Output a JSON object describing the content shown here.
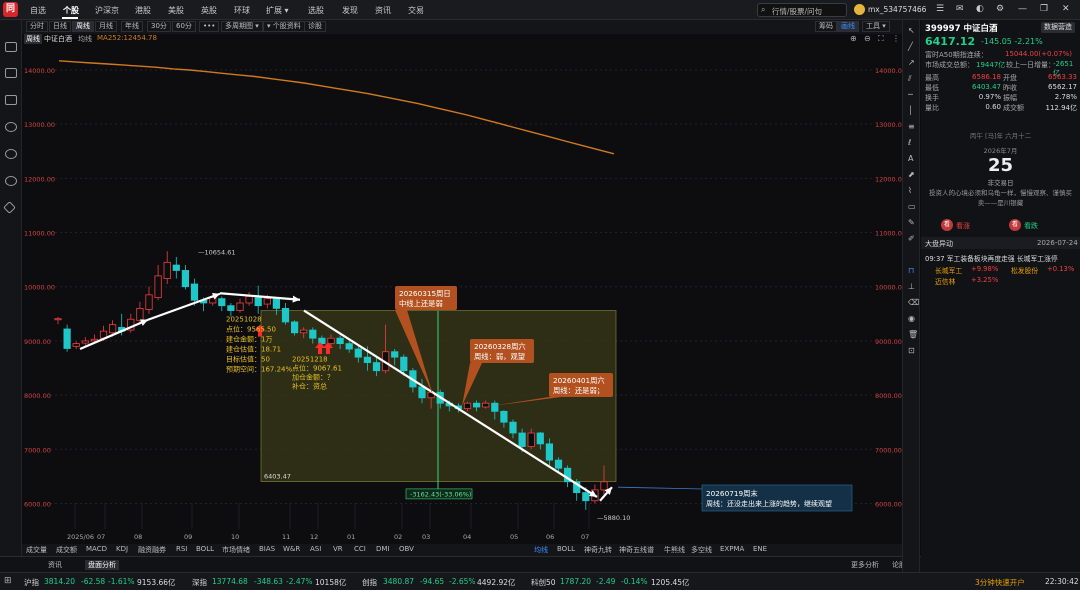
{
  "app": {
    "logo": "同花顺",
    "title": "中证白酒"
  },
  "nav": [
    {
      "label": "自选",
      "x": 30
    },
    {
      "label": "个股",
      "x": 63,
      "active": true
    },
    {
      "label": "沪深京",
      "x": 95
    },
    {
      "label": "港股",
      "x": 135
    },
    {
      "label": "美股",
      "x": 168
    },
    {
      "label": "英股",
      "x": 201
    },
    {
      "label": "环球",
      "x": 234
    },
    {
      "label": "扩展 ▾",
      "x": 266
    },
    {
      "label": "选股",
      "x": 308
    },
    {
      "label": "发现",
      "x": 342
    },
    {
      "label": "资讯",
      "x": 375
    },
    {
      "label": "交易",
      "x": 408
    }
  ],
  "search": {
    "placeholder": "行情/股票/问句"
  },
  "user": {
    "name": "mx_534757466"
  },
  "toolbar": [
    {
      "label": "分时",
      "x": 4
    },
    {
      "label": "日线",
      "x": 27
    },
    {
      "label": "周线",
      "x": 50,
      "sel": true
    },
    {
      "label": "月线",
      "x": 73
    },
    {
      "label": "年线",
      "x": 99
    },
    {
      "label": "30分",
      "x": 125
    },
    {
      "label": "60分",
      "x": 150
    },
    {
      "label": "•••",
      "x": 177
    },
    {
      "label": "多周期图 ▾",
      "x": 199
    },
    {
      "label": "▾ 个股资料",
      "x": 241
    },
    {
      "label": "诊股",
      "x": 282
    }
  ],
  "toolbar_right": [
    {
      "label": "筹码",
      "x": 793
    },
    {
      "label": "画线",
      "x": 815,
      "sel": true
    },
    {
      "label": "工具 ▾",
      "x": 840
    }
  ],
  "legend": {
    "period": "周线",
    "name": "中证白酒",
    "ma_label": "均线",
    "ma": "MA252:12454.78"
  },
  "chart_data": {
    "type": "candlestick",
    "y_ticks": [
      14000,
      13000,
      12000,
      11000,
      10000,
      9000,
      8000,
      7000,
      6000
    ],
    "y_tick_labels": [
      "14000.00",
      "13000.00",
      "12000.00",
      "11000.00",
      "10000.00",
      "9000.00",
      "8000.00",
      "7000.00",
      "6000.00"
    ],
    "x_labels": [
      "2025/06",
      "07",
      "08",
      "09",
      "10",
      "11",
      "12",
      "01",
      "02",
      "03",
      "04",
      "05",
      "06",
      "07"
    ],
    "high_label": "10654.61",
    "low_label": "5880.10",
    "box_low_label": "6403.47",
    "measure_label": "-3162.43(-33.06%)",
    "candles": [
      [
        9390,
        9410,
        9310,
        9440
      ],
      [
        9220,
        8860,
        8800,
        9300
      ],
      [
        8900,
        8950,
        8850,
        8990
      ],
      [
        8960,
        9000,
        8920,
        9070
      ],
      [
        9000,
        9030,
        8960,
        9120
      ],
      [
        9050,
        9180,
        9000,
        9280
      ],
      [
        9150,
        9300,
        9080,
        9380
      ],
      [
        9250,
        9180,
        9100,
        9500
      ],
      [
        9200,
        9400,
        9150,
        9500
      ],
      [
        9380,
        9600,
        9300,
        9720
      ],
      [
        9580,
        9850,
        9500,
        10000
      ],
      [
        9800,
        10200,
        9750,
        10400
      ],
      [
        10150,
        10450,
        10050,
        10654
      ],
      [
        10400,
        10300,
        10150,
        10550
      ],
      [
        10300,
        10000,
        9950,
        10400
      ],
      [
        10050,
        9750,
        9650,
        10150
      ],
      [
        9750,
        9700,
        9550,
        9800
      ],
      [
        9700,
        9800,
        9650,
        9850
      ],
      [
        9780,
        9650,
        9550,
        9820
      ],
      [
        9650,
        9560,
        9450,
        9700
      ],
      [
        9560,
        9700,
        9520,
        9780
      ],
      [
        9700,
        9820,
        9650,
        9900
      ],
      [
        9800,
        9650,
        9500,
        10020
      ],
      [
        9680,
        9780,
        9600,
        9850
      ],
      [
        9770,
        9600,
        9480,
        9800
      ],
      [
        9600,
        9350,
        9300,
        9700
      ],
      [
        9350,
        9150,
        9100,
        9380
      ],
      [
        9150,
        9200,
        9050,
        9250
      ],
      [
        9200,
        9050,
        8950,
        9250
      ],
      [
        9050,
        8950,
        8880,
        9100
      ],
      [
        8950,
        9050,
        8900,
        9120
      ],
      [
        9050,
        8950,
        8850,
        9100
      ],
      [
        8950,
        8850,
        8780,
        9000
      ],
      [
        8850,
        8700,
        8600,
        8900
      ],
      [
        8700,
        8600,
        8450,
        8900
      ],
      [
        8600,
        8450,
        8350,
        8700
      ],
      [
        8450,
        8800,
        8400,
        9300
      ],
      [
        8800,
        8700,
        8550,
        8850
      ],
      [
        8700,
        8450,
        8350,
        8750
      ],
      [
        8450,
        8150,
        8050,
        8500
      ],
      [
        8150,
        7950,
        7850,
        8300
      ],
      [
        7950,
        8050,
        7750,
        8100
      ],
      [
        8050,
        7850,
        7750,
        8100
      ],
      [
        7850,
        7800,
        7700,
        7900
      ],
      [
        7800,
        7750,
        7680,
        7850
      ],
      [
        7750,
        7850,
        7700,
        7880
      ],
      [
        7850,
        7780,
        7700,
        7900
      ],
      [
        7780,
        7850,
        7750,
        7900
      ],
      [
        7850,
        7700,
        7550,
        7900
      ],
      [
        7700,
        7500,
        7400,
        7720
      ],
      [
        7500,
        7300,
        7200,
        7550
      ],
      [
        7300,
        7050,
        6950,
        7380
      ],
      [
        7050,
        7300,
        7000,
        7380
      ],
      [
        7300,
        7100,
        7000,
        7320
      ],
      [
        7100,
        6800,
        6700,
        7200
      ],
      [
        6800,
        6650,
        6550,
        6850
      ],
      [
        6650,
        6400,
        6300,
        6700
      ],
      [
        6400,
        6200,
        6050,
        6450
      ],
      [
        6200,
        6050,
        5880,
        6300
      ],
      [
        6050,
        6250,
        6000,
        6350
      ],
      [
        6250,
        6400,
        6150,
        6700
      ]
    ],
    "ma252": [
      14170,
      14150,
      14130,
      14110,
      14090,
      14070,
      14050,
      14020,
      14000,
      13970,
      13940,
      13910,
      13880,
      13840,
      13800,
      13760,
      13710,
      13660,
      13610,
      13560,
      13500,
      13440,
      13380,
      13310,
      13240,
      13170,
      13090,
      13010,
      12930,
      12850,
      12770,
      12690,
      12610,
      12530,
      12454
    ]
  },
  "annotations": [
    {
      "lines": [
        "20251028",
        "点位：9565.50",
        "建仓金额：1万",
        "建仓估值：18.71",
        "目标估值：50",
        "预期空间：167.24%"
      ]
    },
    {
      "lines": [
        "20251218",
        "点位：9067.61",
        "加仓金额：？",
        "补仓：资总"
      ]
    },
    {
      "box": "20260315周日",
      "sub": "中线上还是弱"
    },
    {
      "box": "20260328周六",
      "sub": "周线：弱，观望"
    },
    {
      "box": "20260401周六",
      "sub": "周线：还是弱；"
    },
    {
      "box": "20260719周末",
      "sub": "周线：还没走出来上涨的趋势，继续观望"
    }
  ],
  "bottom_tabs": [
    {
      "label": "成交量",
      "x": 4
    },
    {
      "label": "成交额",
      "x": 34
    },
    {
      "label": "MACD",
      "x": 64
    },
    {
      "label": "KDJ",
      "x": 94
    },
    {
      "label": "融资融券",
      "x": 116
    },
    {
      "label": "RSI",
      "x": 154
    },
    {
      "label": "BOLL",
      "x": 174
    },
    {
      "label": "市场情绪",
      "x": 200
    },
    {
      "label": "BIAS",
      "x": 237
    },
    {
      "label": "W&R",
      "x": 261
    },
    {
      "label": "ASI",
      "x": 288
    },
    {
      "label": "VR",
      "x": 311
    },
    {
      "label": "CCI",
      "x": 332
    },
    {
      "label": "DMI",
      "x": 354
    },
    {
      "label": "OBV",
      "x": 377
    },
    {
      "label": "均线",
      "x": 512,
      "sel": true
    },
    {
      "label": "BOLL",
      "x": 535
    },
    {
      "label": "神奇九转",
      "x": 562
    },
    {
      "label": "神奇五线谱",
      "x": 597
    },
    {
      "label": "牛熊线",
      "x": 642
    },
    {
      "label": "多空线",
      "x": 669
    },
    {
      "label": "EXPMA",
      "x": 698
    },
    {
      "label": "ENE",
      "x": 731
    }
  ],
  "panel_tabs": [
    {
      "label": "资讯",
      "x": 48
    },
    {
      "label": "盘面分析",
      "x": 85,
      "sel": true
    }
  ],
  "panel_right": [
    {
      "label": "更多分析",
      "x": 851
    },
    {
      "label": "论股堂",
      "x": 892
    },
    {
      "label": "异动",
      "x": 928,
      "sel": true
    },
    {
      "label": "盘口",
      "x": 957
    }
  ],
  "quote": {
    "code": "399997 中证白酒",
    "button": "数据营造",
    "price": "6417.12",
    "change": "-145.05  -2.21%",
    "extra1_label": "富时A50期指连续：",
    "extra1_value": "15044.00(+0.07%)",
    "extra2_label": "市场成交总额：",
    "extra2_value": "19447亿",
    "extra3_label": "较上一日增量：",
    "extra3_value": "-2651亿",
    "rows": [
      {
        "l": "最高",
        "v": "6586.18",
        "c": "red",
        "l2": "开盘",
        "v2": "6563.33",
        "c2": "red"
      },
      {
        "l": "最低",
        "v": "6403.47",
        "c": "green",
        "l2": "昨收",
        "v2": "6562.17",
        "c2": "white"
      },
      {
        "l": "换手",
        "v": "0.97%",
        "c": "white",
        "l2": "振幅",
        "v2": "2.78%",
        "c2": "white"
      },
      {
        "l": "量比",
        "v": "0.60",
        "c": "white",
        "l2": "成交额",
        "v2": "112.94亿",
        "c2": "white"
      }
    ],
    "lunar": "丙午 [马]年 六月十二",
    "date": "2026年7月",
    "day": "25",
    "day_note": "非交易日",
    "quote_text": "投资人的心境必须和乌龟一样，慢慢观察、谨慎买卖——是川银藏",
    "buy": "看涨",
    "sell": "看跌",
    "alert_title": "大盘异动",
    "alert_date": "2026-07-24",
    "alert_line": "09:37 军工装备板块再度走强 长城军工涨停",
    "alert_stocks": [
      [
        "长城军工",
        "+9.98%",
        "松发股份",
        "+0.13%"
      ],
      [
        "迈信林",
        "+3.25%",
        "",
        ""
      ]
    ]
  },
  "statusbar": [
    {
      "label": "沪指",
      "x": 24,
      "c": "white"
    },
    {
      "label": "3814.20",
      "x": 44,
      "c": "green"
    },
    {
      "label": "-62.58",
      "x": 81,
      "c": "green"
    },
    {
      "label": "-1.61%",
      "x": 108,
      "c": "green"
    },
    {
      "label": "9153.66亿",
      "x": 137,
      "c": "white"
    },
    {
      "label": "深指",
      "x": 192,
      "c": "white"
    },
    {
      "label": "13774.68",
      "x": 212,
      "c": "green"
    },
    {
      "label": "-348.63",
      "x": 254,
      "c": "green"
    },
    {
      "label": "-2.47%",
      "x": 286,
      "c": "green"
    },
    {
      "label": "10158亿",
      "x": 315,
      "c": "white"
    },
    {
      "label": "创指",
      "x": 362,
      "c": "white"
    },
    {
      "label": "3480.87",
      "x": 383,
      "c": "green"
    },
    {
      "label": "-94.65",
      "x": 420,
      "c": "green"
    },
    {
      "label": "-2.65%",
      "x": 449,
      "c": "green"
    },
    {
      "label": "4492.92亿",
      "x": 477,
      "c": "white"
    },
    {
      "label": "科创50",
      "x": 531,
      "c": "white"
    },
    {
      "label": "1787.20",
      "x": 560,
      "c": "green"
    },
    {
      "label": "-2.49",
      "x": 596,
      "c": "green"
    },
    {
      "label": "-0.14%",
      "x": 621,
      "c": "green"
    },
    {
      "label": "1205.45亿",
      "x": 651,
      "c": "white"
    },
    {
      "label": "3分钟快速开户",
      "x": 975,
      "c": "orange"
    },
    {
      "label": "22:30:42",
      "x": 1045,
      "c": "white"
    }
  ],
  "colors": {
    "up": "#ef4040",
    "down": "#1fc8c8",
    "ma": "#d07a20",
    "box": "#3a3a18",
    "accent": "#2a7fff"
  }
}
